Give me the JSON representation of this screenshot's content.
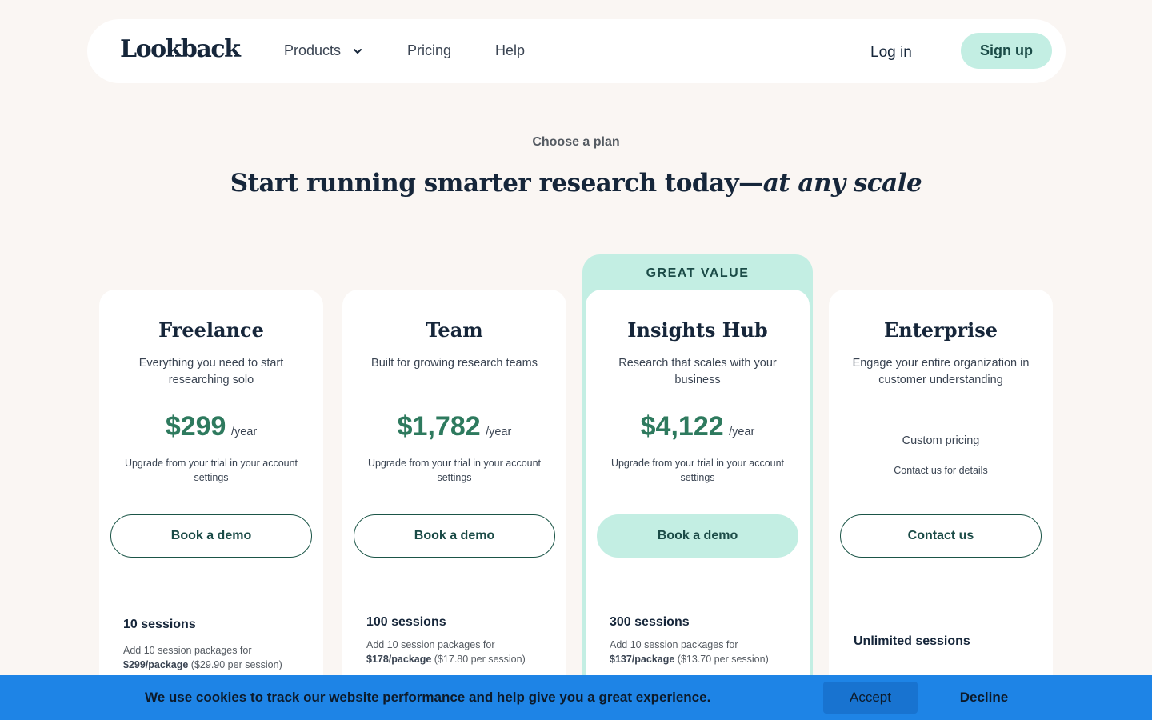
{
  "brand": {
    "logo_text": "Lookback"
  },
  "nav": {
    "products": "Products",
    "pricing": "Pricing",
    "help": "Help",
    "login": "Log in",
    "signup": "Sign up"
  },
  "hero": {
    "eyebrow": "Choose a plan",
    "headline_plain": "Start running smarter research today—",
    "headline_italic": "at any scale"
  },
  "badge": "GREAT VALUE",
  "plans": [
    {
      "name": "Freelance",
      "description": "Everything you need to start researching solo",
      "price": "$299",
      "period": "/year",
      "note": "Upgrade from your trial in your account settings",
      "cta": "Book a demo",
      "sessions": "10 sessions",
      "addon_prefix": "Add 10 session packages for",
      "addon_price": "$299/package",
      "addon_per": "($29.90 per session)"
    },
    {
      "name": "Team",
      "description": "Built for growing research teams",
      "price": "$1,782",
      "period": "/year",
      "note": "Upgrade from your trial in your account settings",
      "cta": "Book a demo",
      "sessions": "100 sessions",
      "addon_prefix": "Add 10 session packages for",
      "addon_price": "$178/package",
      "addon_per": "($17.80 per session)"
    },
    {
      "name": "Insights Hub",
      "description": "Research that scales with your business",
      "price": "$4,122",
      "period": "/year",
      "note": "Upgrade from your trial in your account settings",
      "cta": "Book a demo",
      "sessions": "300 sessions",
      "addon_prefix": "Add 10 session packages for",
      "addon_price": "$137/package",
      "addon_per": "($13.70 per session)"
    },
    {
      "name": "Enterprise",
      "description": "Engage your entire organization in customer understanding",
      "custom_pricing": "Custom pricing",
      "contact_note": "Contact us for details",
      "cta": "Contact us",
      "sessions": "Unlimited sessions"
    }
  ],
  "cookie": {
    "message": "We use cookies to track our website performance and help give you a great experience.",
    "accept": "Accept",
    "decline": "Decline"
  },
  "colors": {
    "background": "#faf6f3",
    "accent_mint": "#c3eee3",
    "price_green": "#2e7a5e",
    "cookie_blue": "#1e84e6",
    "navy_text": "#16263a"
  }
}
